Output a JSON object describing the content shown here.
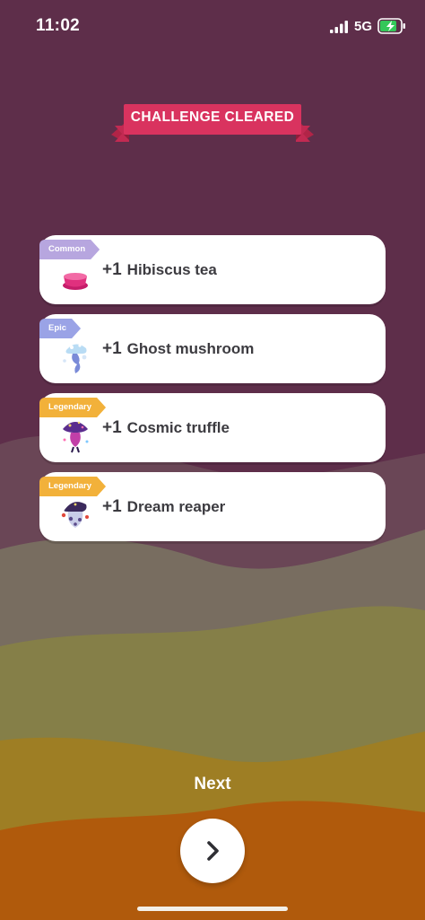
{
  "status_bar": {
    "time": "11:02",
    "network": "5G"
  },
  "banner": {
    "title": "CHALLENGE CLEARED"
  },
  "rewards": [
    {
      "rarity": "Common",
      "quantity": "+1",
      "name": "Hibiscus tea",
      "icon": "hibiscus-tea-icon"
    },
    {
      "rarity": "Epic",
      "quantity": "+1",
      "name": "Ghost mushroom",
      "icon": "ghost-mushroom-icon"
    },
    {
      "rarity": "Legendary",
      "quantity": "+1",
      "name": "Cosmic truffle",
      "icon": "cosmic-truffle-icon"
    },
    {
      "rarity": "Legendary",
      "quantity": "+1",
      "name": "Dream reaper",
      "icon": "dream-reaper-icon"
    }
  ],
  "next": {
    "label": "Next",
    "icon": "chevron-right-icon"
  },
  "colors": {
    "background": "#5e2e4a",
    "banner": "#d9335f",
    "common": "#b7a6df",
    "epic": "#9aa3e6",
    "legendary": "#f2b13a"
  }
}
